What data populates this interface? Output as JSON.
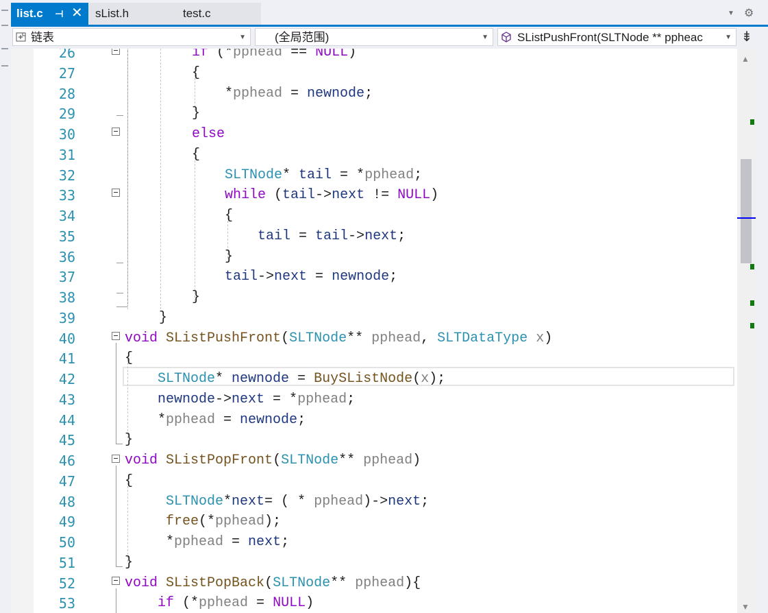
{
  "tabs": [
    {
      "label": "list.c",
      "active": true
    },
    {
      "label": "sList.h",
      "active": false
    },
    {
      "label": "test.c",
      "active": false
    }
  ],
  "tab_icons": {
    "pin": "pin-icon",
    "close": "close-icon",
    "dropdown": "chevron-down-icon",
    "settings": "gear-icon"
  },
  "navbar": {
    "project": "链表",
    "scope": "(全局范围)",
    "member": "SListPushFront(SLTNode ** ppheac"
  },
  "colors": {
    "accent": "#007acc",
    "keyword": "#8f08c4",
    "type": "#2b91af",
    "param": "#808080",
    "function": "#74531f",
    "identifier": "#1f377f"
  },
  "line_numbers": [
    "26",
    "27",
    "28",
    "29",
    "30",
    "31",
    "32",
    "33",
    "34",
    "35",
    "36",
    "37",
    "38",
    "39",
    "40",
    "41",
    "42",
    "43",
    "44",
    "45",
    "46",
    "47",
    "48",
    "49",
    "50",
    "51",
    "52",
    "53"
  ],
  "code_lines": [
    [
      {
        "c": "k",
        "t": "if"
      },
      {
        "c": "op",
        "t": " ("
      },
      {
        "c": "op",
        "t": "*"
      },
      {
        "c": "p",
        "t": "pphead"
      },
      {
        "c": "op",
        "t": " == "
      },
      {
        "c": "k",
        "t": "NULL"
      },
      {
        "c": "op",
        "t": ")"
      }
    ],
    [
      {
        "c": "op",
        "t": "{"
      }
    ],
    [
      {
        "c": "op",
        "t": "*"
      },
      {
        "c": "p",
        "t": "pphead"
      },
      {
        "c": "op",
        "t": " = "
      },
      {
        "c": "id",
        "t": "newnode"
      },
      {
        "c": "op",
        "t": ";"
      }
    ],
    [
      {
        "c": "op",
        "t": "}"
      }
    ],
    [
      {
        "c": "k",
        "t": "else"
      }
    ],
    [
      {
        "c": "op",
        "t": "{"
      }
    ],
    [
      {
        "c": "t",
        "t": "SLTNode"
      },
      {
        "c": "op",
        "t": "* "
      },
      {
        "c": "id",
        "t": "tail"
      },
      {
        "c": "op",
        "t": " = *"
      },
      {
        "c": "p",
        "t": "pphead"
      },
      {
        "c": "op",
        "t": ";"
      }
    ],
    [
      {
        "c": "k",
        "t": "while"
      },
      {
        "c": "op",
        "t": " ("
      },
      {
        "c": "id",
        "t": "tail"
      },
      {
        "c": "op",
        "t": "->"
      },
      {
        "c": "id",
        "t": "next"
      },
      {
        "c": "op",
        "t": " != "
      },
      {
        "c": "k",
        "t": "NULL"
      },
      {
        "c": "op",
        "t": ")"
      }
    ],
    [
      {
        "c": "op",
        "t": "{"
      }
    ],
    [
      {
        "c": "id",
        "t": "tail"
      },
      {
        "c": "op",
        "t": " = "
      },
      {
        "c": "id",
        "t": "tail"
      },
      {
        "c": "op",
        "t": "->"
      },
      {
        "c": "id",
        "t": "next"
      },
      {
        "c": "op",
        "t": ";"
      }
    ],
    [
      {
        "c": "op",
        "t": "}"
      }
    ],
    [
      {
        "c": "id",
        "t": "tail"
      },
      {
        "c": "op",
        "t": "->"
      },
      {
        "c": "id",
        "t": "next"
      },
      {
        "c": "op",
        "t": " = "
      },
      {
        "c": "id",
        "t": "newnode"
      },
      {
        "c": "op",
        "t": ";"
      }
    ],
    [
      {
        "c": "op",
        "t": "}"
      }
    ],
    [
      {
        "c": "op",
        "t": "}"
      }
    ],
    [
      {
        "c": "k",
        "t": "void"
      },
      {
        "c": "op",
        "t": " "
      },
      {
        "c": "f",
        "t": "SListPushFront"
      },
      {
        "c": "op",
        "t": "("
      },
      {
        "c": "t",
        "t": "SLTNode"
      },
      {
        "c": "op",
        "t": "** "
      },
      {
        "c": "p",
        "t": "pphead"
      },
      {
        "c": "op",
        "t": ", "
      },
      {
        "c": "t",
        "t": "SLTDataType"
      },
      {
        "c": "op",
        "t": " "
      },
      {
        "c": "p",
        "t": "x"
      },
      {
        "c": "op",
        "t": ")"
      }
    ],
    [
      {
        "c": "op",
        "t": "{"
      }
    ],
    [
      {
        "c": "t",
        "t": "SLTNode"
      },
      {
        "c": "op",
        "t": "* "
      },
      {
        "c": "id",
        "t": "newnode"
      },
      {
        "c": "op",
        "t": " = "
      },
      {
        "c": "f",
        "t": "BuySListNode"
      },
      {
        "c": "op",
        "t": "("
      },
      {
        "c": "p",
        "t": "x"
      },
      {
        "c": "op",
        "t": ");"
      }
    ],
    [
      {
        "c": "id",
        "t": "newnode"
      },
      {
        "c": "op",
        "t": "->"
      },
      {
        "c": "id",
        "t": "next"
      },
      {
        "c": "op",
        "t": " = *"
      },
      {
        "c": "p",
        "t": "pphead"
      },
      {
        "c": "op",
        "t": ";"
      }
    ],
    [
      {
        "c": "op",
        "t": "*"
      },
      {
        "c": "p",
        "t": "pphead"
      },
      {
        "c": "op",
        "t": " = "
      },
      {
        "c": "id",
        "t": "newnode"
      },
      {
        "c": "op",
        "t": ";"
      }
    ],
    [
      {
        "c": "op",
        "t": "}"
      }
    ],
    [
      {
        "c": "k",
        "t": "void"
      },
      {
        "c": "op",
        "t": " "
      },
      {
        "c": "f",
        "t": "SListPopFront"
      },
      {
        "c": "op",
        "t": "("
      },
      {
        "c": "t",
        "t": "SLTNode"
      },
      {
        "c": "op",
        "t": "** "
      },
      {
        "c": "p",
        "t": "pphead"
      },
      {
        "c": "op",
        "t": ")"
      }
    ],
    [
      {
        "c": "op",
        "t": "{"
      }
    ],
    [
      {
        "c": "t",
        "t": "SLTNode"
      },
      {
        "c": "op",
        "t": "*"
      },
      {
        "c": "id",
        "t": "next"
      },
      {
        "c": "op",
        "t": "= ( * "
      },
      {
        "c": "p",
        "t": "pphead"
      },
      {
        "c": "op",
        "t": ")->"
      },
      {
        "c": "id",
        "t": "next"
      },
      {
        "c": "op",
        "t": ";"
      }
    ],
    [
      {
        "c": "f",
        "t": "free"
      },
      {
        "c": "op",
        "t": "(*"
      },
      {
        "c": "p",
        "t": "pphead"
      },
      {
        "c": "op",
        "t": ");"
      }
    ],
    [
      {
        "c": "op",
        "t": "*"
      },
      {
        "c": "p",
        "t": "pphead"
      },
      {
        "c": "op",
        "t": " = "
      },
      {
        "c": "id",
        "t": "next"
      },
      {
        "c": "op",
        "t": ";"
      }
    ],
    [
      {
        "c": "op",
        "t": "}"
      }
    ],
    [
      {
        "c": "k",
        "t": "void"
      },
      {
        "c": "op",
        "t": " "
      },
      {
        "c": "f",
        "t": "SListPopBack"
      },
      {
        "c": "op",
        "t": "("
      },
      {
        "c": "t",
        "t": "SLTNode"
      },
      {
        "c": "op",
        "t": "** "
      },
      {
        "c": "p",
        "t": "pphead"
      },
      {
        "c": "op",
        "t": "){"
      }
    ],
    [
      {
        "c": "k",
        "t": "if"
      },
      {
        "c": "op",
        "t": " (*"
      },
      {
        "c": "p",
        "t": "pphead"
      },
      {
        "c": "op",
        "t": " = "
      },
      {
        "c": "k",
        "t": "NULL"
      },
      {
        "c": "op",
        "t": ")"
      }
    ]
  ]
}
